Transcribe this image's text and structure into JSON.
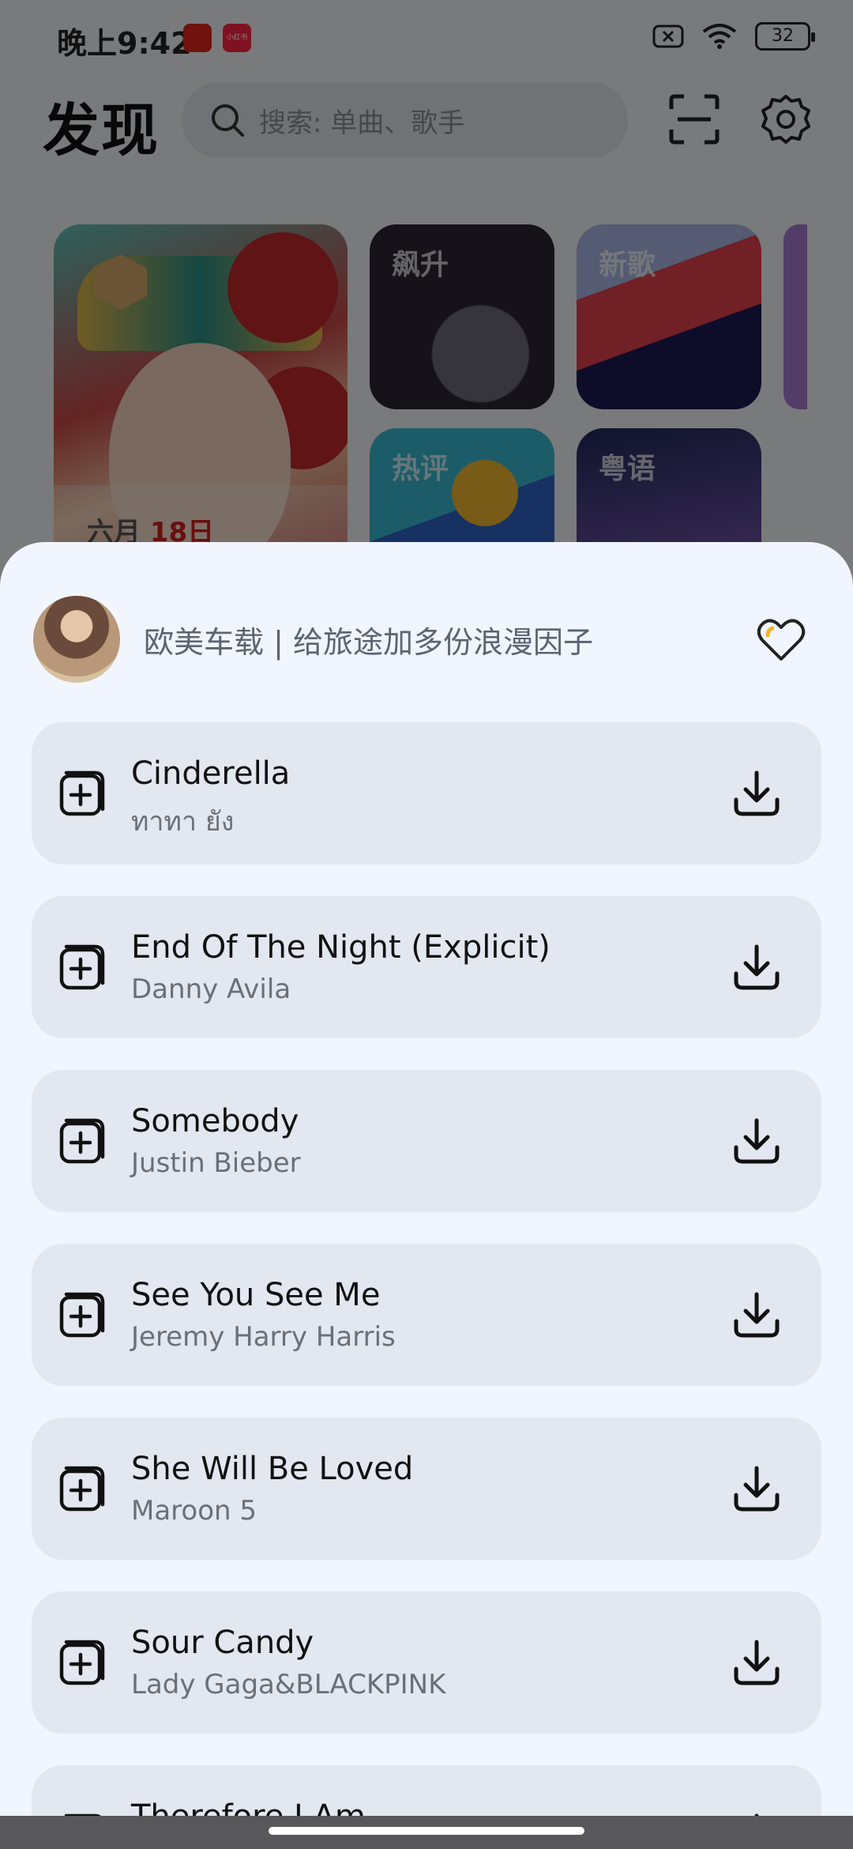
{
  "status_bar": {
    "time": "晚上9:42",
    "app_badge": "小红书",
    "battery": "32"
  },
  "header": {
    "title": "发现",
    "search_placeholder": "搜索: 单曲、歌手"
  },
  "cards": {
    "daily_month": "六月",
    "daily_day": "18日",
    "rising": "飙升",
    "new_songs": "新歌",
    "hot_comments": "热评",
    "cantonese": "粤语"
  },
  "sheet": {
    "playlist_title": "欧美车载 | 给旅途加多份浪漫因子",
    "songs": [
      {
        "title": "Cinderella",
        "artist": "ทาทา ยัง"
      },
      {
        "title": "End Of The Night (Explicit)",
        "artist": "Danny Avila"
      },
      {
        "title": "Somebody",
        "artist": "Justin Bieber"
      },
      {
        "title": "See You See Me",
        "artist": "Jeremy Harry Harris"
      },
      {
        "title": "She Will Be Loved",
        "artist": "Maroon 5"
      },
      {
        "title": "Sour Candy",
        "artist": "Lady Gaga&BLACKPINK"
      },
      {
        "title": "Therefore I Am",
        "artist": ""
      }
    ]
  },
  "colors": {
    "accent_heart": "#f0b62d",
    "sheet_bg": "#f1f5fd",
    "row_bg": "#e2e7f0"
  },
  "icons": [
    "search-icon",
    "scan-icon",
    "settings-icon",
    "heart-icon",
    "add-to-playlist-icon",
    "download-icon"
  ]
}
